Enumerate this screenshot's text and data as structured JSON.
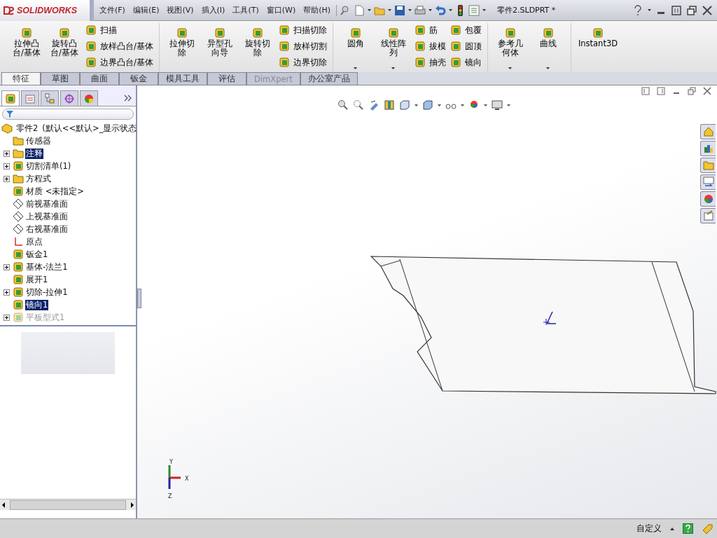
{
  "title_bar": {
    "brand": "SOLIDWORKS",
    "menus": [
      "文件(F)",
      "编辑(E)",
      "视图(V)",
      "插入(I)",
      "工具(T)",
      "窗口(W)",
      "帮助(H)"
    ],
    "document_title": "零件2.SLDPRT *"
  },
  "command_groups": [
    {
      "items": [
        {
          "kind": "large",
          "label": "拉伸凸台/基体"
        },
        {
          "kind": "large",
          "label": "旋转凸台/基体"
        },
        {
          "kind": "column",
          "items": [
            "扫描",
            "放样凸台/基体",
            "边界凸台/基体"
          ]
        }
      ]
    },
    {
      "items": [
        {
          "kind": "large",
          "label": "拉伸切除"
        },
        {
          "kind": "large",
          "label": "异型孔向导"
        },
        {
          "kind": "large",
          "label": "旋转切除"
        },
        {
          "kind": "column",
          "items": [
            "扫描切除",
            "放样切割",
            "边界切除"
          ]
        }
      ]
    },
    {
      "items": [
        {
          "kind": "dropdown",
          "label": "圆角"
        },
        {
          "kind": "dropdown",
          "label": "线性阵列"
        },
        {
          "kind": "column",
          "items": [
            "筋",
            "拔模",
            "抽壳"
          ]
        },
        {
          "kind": "column",
          "items": [
            "包覆",
            "圆顶",
            "镜向"
          ]
        }
      ]
    },
    {
      "items": [
        {
          "kind": "dropdown",
          "label": "参考几何体"
        },
        {
          "kind": "dropdown",
          "label": "曲线"
        }
      ]
    },
    {
      "items": [
        {
          "kind": "wide",
          "label": "Instant3D"
        }
      ]
    }
  ],
  "tabs": [
    {
      "label": "特征",
      "selected": true,
      "disabled": false
    },
    {
      "label": "草图",
      "selected": false,
      "disabled": false
    },
    {
      "label": "曲面",
      "selected": false,
      "disabled": false
    },
    {
      "label": "钣金",
      "selected": false,
      "disabled": false
    },
    {
      "label": "模具工具",
      "selected": false,
      "disabled": false
    },
    {
      "label": "评估",
      "selected": false,
      "disabled": false
    },
    {
      "label": "DimXpert",
      "selected": false,
      "disabled": true
    },
    {
      "label": "办公室产品",
      "selected": false,
      "disabled": false
    }
  ],
  "panel_tabs": [
    {
      "selected": true
    },
    {
      "selected": false
    },
    {
      "selected": false
    },
    {
      "selected": false
    },
    {
      "selected": false
    }
  ],
  "feature_tree": {
    "root": {
      "label": "零件2",
      "configuration": "(默认<<默认>_显示状态"
    },
    "items": [
      {
        "label": "传感器",
        "selected": false,
        "suppressed": false
      },
      {
        "label": "注释",
        "selected": true,
        "suppressed": false,
        "expanded": false
      },
      {
        "label": "切割清单(1)",
        "selected": false,
        "suppressed": false,
        "expanded": false
      },
      {
        "label": "方程式",
        "selected": false,
        "suppressed": false,
        "expanded": false
      },
      {
        "label": "材质 <未指定>",
        "selected": false,
        "suppressed": false
      },
      {
        "label": "前视基准面",
        "selected": false,
        "suppressed": false
      },
      {
        "label": "上视基准面",
        "selected": false,
        "suppressed": false
      },
      {
        "label": "右视基准面",
        "selected": false,
        "suppressed": false
      },
      {
        "label": "原点",
        "selected": false,
        "suppressed": false
      },
      {
        "label": "钣金1",
        "selected": false,
        "suppressed": false
      },
      {
        "label": "基体-法兰1",
        "selected": false,
        "suppressed": false,
        "expanded": false
      },
      {
        "label": "展开1",
        "selected": false,
        "suppressed": false
      },
      {
        "label": "切除-拉伸1",
        "selected": false,
        "suppressed": false,
        "expanded": false
      },
      {
        "label": "镜向1",
        "selected": true,
        "suppressed": false
      },
      {
        "label": "平板型式1",
        "selected": false,
        "suppressed": true,
        "expanded": false
      }
    ]
  },
  "viewport": {
    "triad": [
      "X",
      "Y",
      "Z"
    ]
  },
  "status_bar": {
    "units": "自定义"
  }
}
